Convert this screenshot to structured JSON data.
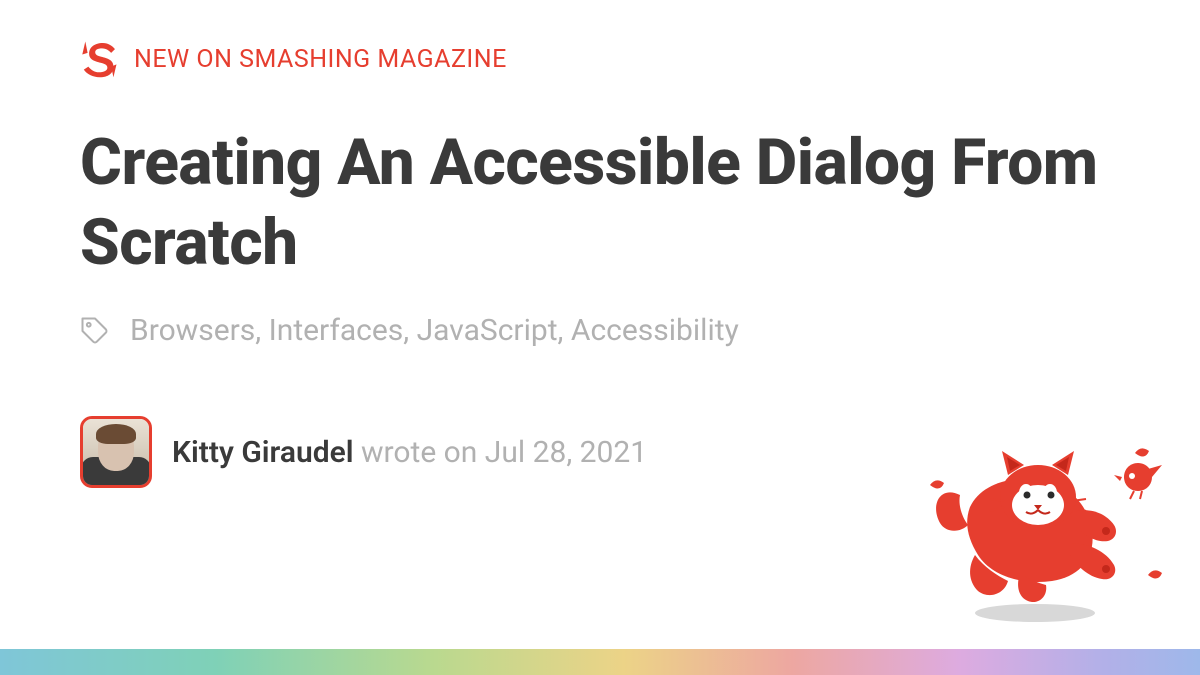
{
  "eyebrow": "NEW ON SMASHING MAGAZINE",
  "title": "Creating An Accessible Dialog From Scratch",
  "tags": "Browsers, Interfaces, JavaScript, Accessibility",
  "author": "Kitty Giraudel",
  "byline_connector": " wrote on ",
  "date": "Jul 28, 2021",
  "brand_color": "#e63e2f"
}
